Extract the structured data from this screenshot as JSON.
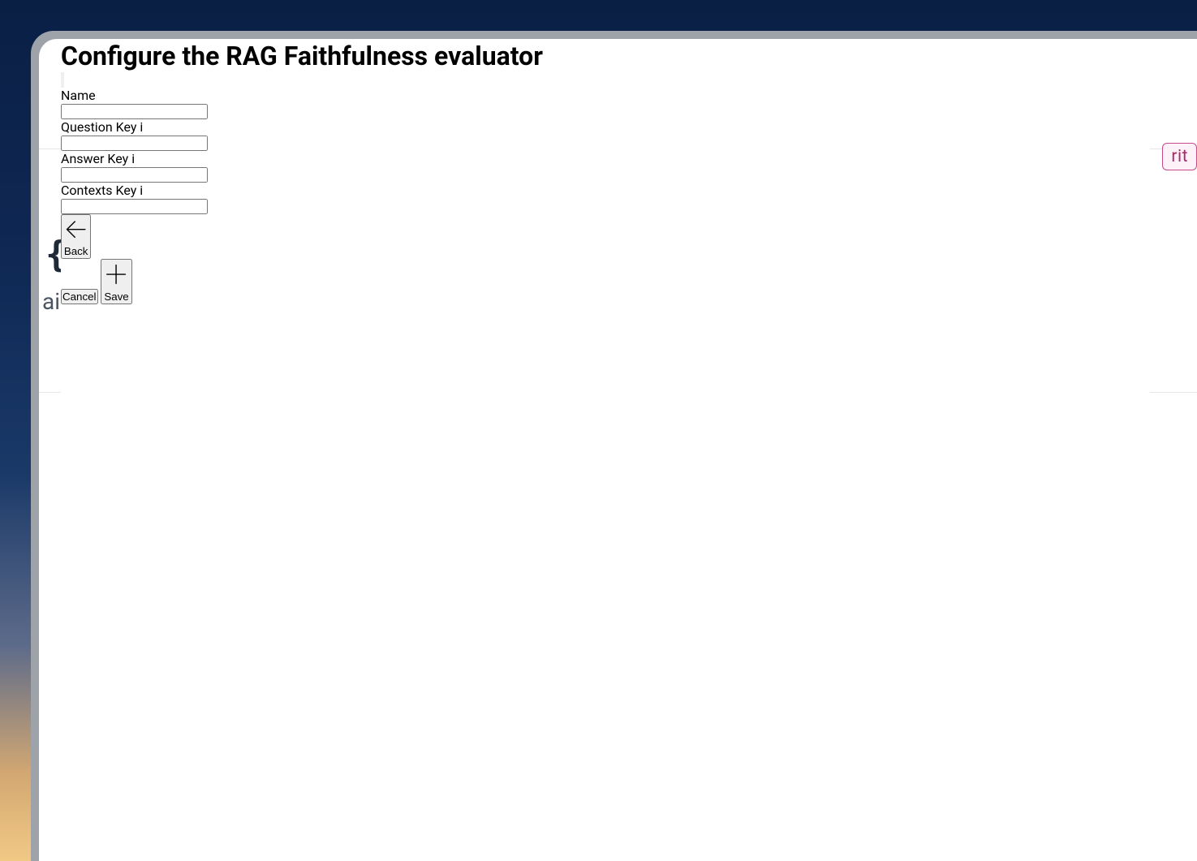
{
  "modal": {
    "title": "Configure the RAG Faithfulness evaluator",
    "fields": {
      "name": {
        "label": "Name",
        "value": "",
        "has_info": false
      },
      "question_key": {
        "label": "Question Key",
        "value": "",
        "has_info": true
      },
      "answer_key": {
        "label": "Answer Key",
        "value": "",
        "has_info": true
      },
      "contexts_key": {
        "label": "Contexts Key",
        "value": "",
        "has_info": true
      }
    },
    "buttons": {
      "back": "Back",
      "cancel": "Cancel",
      "save": "Save"
    }
  },
  "backdrop": {
    "tag_fragment": "rit",
    "braces": "{·",
    "text_fragment": "ai"
  }
}
